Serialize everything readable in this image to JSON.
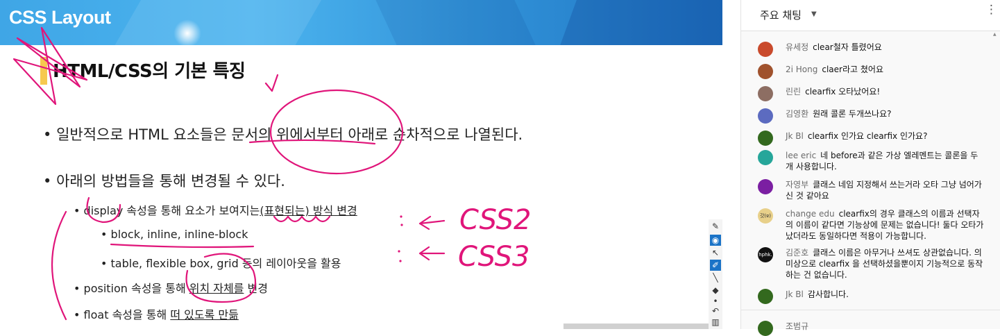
{
  "slide": {
    "banner_title": "CSS Layout",
    "heading": "HTML/CSS의 기본 특징",
    "bullet1": "일반적으로 HTML 요소들은 문서의 위에서부터 아래로 순차적으로 나열된다.",
    "bullet2": "아래의 방법들을 통해 변경될 수 있다.",
    "sub1_pre": "display 속성을 통해 요소가 보여지는",
    "sub1_u": "(표현되는) 방식 변경",
    "sub1a": "block, inline, inline-block",
    "sub1b": "table, flexible box, grid 등의 레이아웃을 활용",
    "sub2_pre": "position 속성을 통해 ",
    "sub2_u": "위치 자체를",
    "sub2_post": " 변경",
    "sub3_pre": "float 속성을 통해 ",
    "sub3_u": "떠 있도록 만듦",
    "bullet_glyph": "•",
    "ink_labels": [
      "CSS2",
      "CSS3"
    ],
    "ink_color": "#e0157a"
  },
  "tools": {
    "items": [
      "pen-tool-icon",
      "eye-icon",
      "select-arrow-icon",
      "highlighter-icon",
      "line-icon",
      "eraser-icon",
      "dot-icon",
      "undo-icon",
      "trash-icon"
    ],
    "active": "eye-icon"
  },
  "chat": {
    "title": "주요 채팅",
    "caret": "▼",
    "menu": "⋮",
    "messages": [
      {
        "author": "유세정",
        "text": "clear철자 틀렸어요",
        "avatar_color": "#c94a2c"
      },
      {
        "author": "2i Hong",
        "text": "claer라고 쳤어요",
        "avatar_color": "#a0522d"
      },
      {
        "author": "린린",
        "text": "clearfix 오타났어요!",
        "avatar_color": "#8d6e63"
      },
      {
        "author": "김영환",
        "text": "원래 콜론 두개쓰나요?",
        "avatar_color": "#5c6bc0"
      },
      {
        "author": "Jk Bl",
        "text": "clearfix 인가요 clearfix 인가요?",
        "avatar_color": "#33691e"
      },
      {
        "author": "lee eric",
        "text": "네 before과 같은 가상 엘레멘트는 콜론을 두 개 사용합니다.",
        "avatar_color": "#26a69a"
      },
      {
        "author": "자영부",
        "text": "클래스 네임 지정해서 쓰는거라 오타 그냥 넘어가신 것 같아요",
        "avatar_color": "#7b1fa2"
      },
      {
        "author": "change edu",
        "text": "clearfix의 경우 클래스의 이름과 선택자의 이름이 같다면 기능상에 문제는 없습니다! 둘다 오타가 났더라도 동일하다면 적용이 가능합니다.",
        "avatar_color": "#e8d08a",
        "avatar_text": "갓(ɐ)"
      },
      {
        "author": "김준호",
        "text": "클래스 이름은 아무거나 쓰셔도 상관없습니다. 의미상으로 clearfix 을 선택하셨을뿐이지 기능적으로 동작하는 건 없습니다.",
        "avatar_color": "#111111",
        "avatar_text": "hphk."
      },
      {
        "author": "Jk Bl",
        "text": "감사합니다.",
        "avatar_color": "#33691e"
      },
      {
        "author": "조범규",
        "text": "",
        "avatar_color": "#33691e"
      }
    ]
  }
}
